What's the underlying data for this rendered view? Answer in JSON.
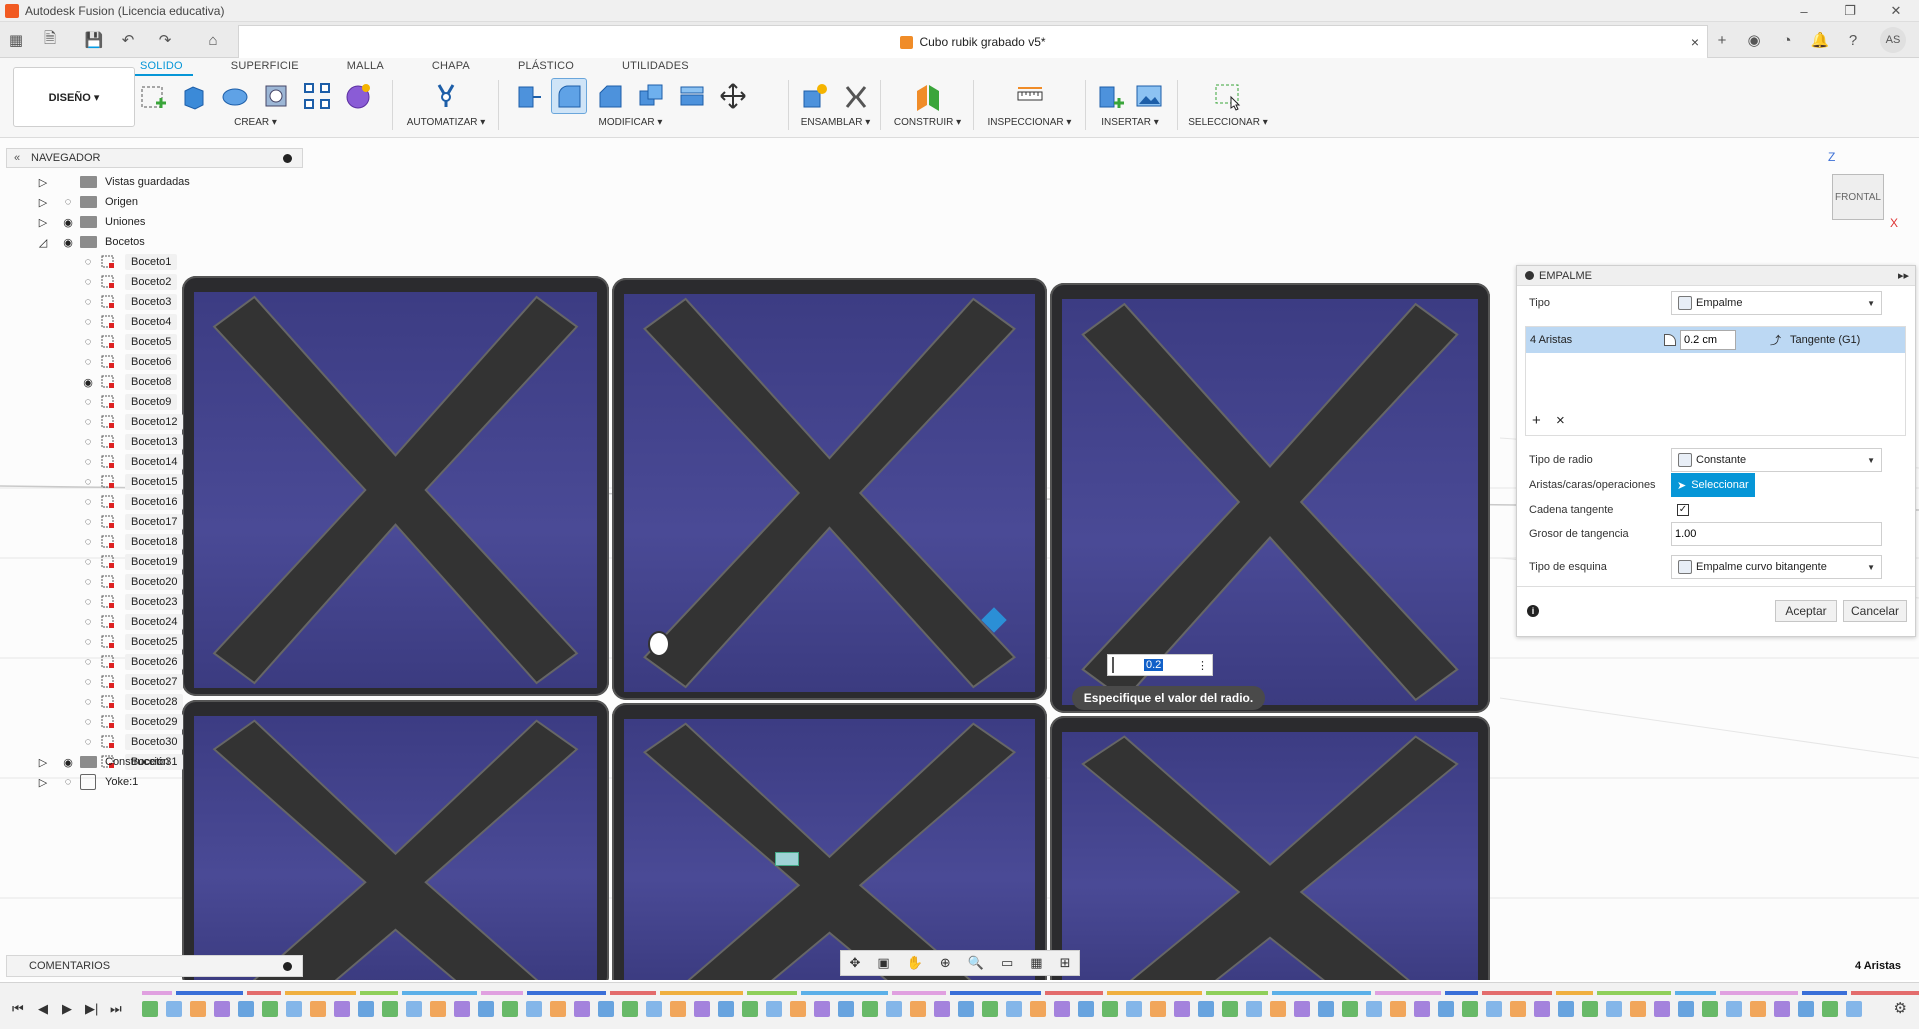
{
  "window": {
    "title": "Autodesk Fusion (Licencia educativa)",
    "min": "–",
    "max": "❐",
    "close": "✕"
  },
  "tabbar": {
    "doc_title": "Cubo rubik grabado v5*",
    "close": "×",
    "avatar": "AS"
  },
  "ribbon": {
    "tabs": [
      "SOLIDO",
      "SUPERFICIE",
      "MALLA",
      "CHAPA",
      "PLÁSTICO",
      "UTILIDADES"
    ],
    "workspace": "DISEÑO ▾",
    "groups": {
      "crear": "CREAR ▾",
      "automatizar": "AUTOMATIZAR ▾",
      "modificar": "MODIFICAR ▾",
      "ensamblar": "ENSAMBLAR ▾",
      "construir": "CONSTRUIR ▾",
      "inspeccionar": "INSPECCIONAR ▾",
      "insertar": "INSERTAR ▾",
      "seleccionar": "SELECCIONAR ▾"
    }
  },
  "navigator": {
    "title": "NAVEGADOR",
    "items": [
      {
        "label": "Vistas guardadas"
      },
      {
        "label": "Origen"
      },
      {
        "label": "Uniones"
      },
      {
        "label": "Bocetos"
      },
      {
        "label": "Construcción"
      },
      {
        "label": "Yoke:1"
      }
    ],
    "sketches": [
      "Boceto1",
      "Boceto2",
      "Boceto3",
      "Boceto4",
      "Boceto5",
      "Boceto6",
      "Boceto8",
      "Boceto9",
      "Boceto12",
      "Boceto13",
      "Boceto14",
      "Boceto15",
      "Boceto16",
      "Boceto17",
      "Boceto18",
      "Boceto19",
      "Boceto20",
      "Boceto23",
      "Boceto24",
      "Boceto25",
      "Boceto26",
      "Boceto27",
      "Boceto28",
      "Boceto29",
      "Boceto30",
      "Boceto31"
    ]
  },
  "comments": {
    "title": "COMENTARIOS"
  },
  "viewcube": {
    "face": "FRONTAL",
    "z": "Z",
    "x": "X"
  },
  "fillet_panel": {
    "title": "EMPALME",
    "tipo_label": "Tipo",
    "tipo_value": "Empalme",
    "edges_label": "4 Aristas",
    "radius_value": "0.2 cm",
    "continuity": "Tangente (G1)",
    "add": "+",
    "remove": "×",
    "tipo_radio_label": "Tipo de radio",
    "tipo_radio_value": "Constante",
    "aristas_label": "Aristas/caras/operaciones",
    "seleccionar": "Seleccionar",
    "cadena_label": "Cadena tangente",
    "grosor_label": "Grosor de tangencia",
    "grosor_value": "1.00",
    "esquina_label": "Tipo de esquina",
    "esquina_value": "Empalme curvo bitangente",
    "info": "i",
    "ok": "Aceptar",
    "cancel": "Cancelar"
  },
  "canvas": {
    "radius_input": "0.2",
    "tooltip": "Especifique el valor del radio."
  },
  "status": {
    "selection": "4 Aristas"
  },
  "colors": {
    "accent": "#0696d7",
    "face": "#40408a",
    "frame": "#2b2b2e"
  }
}
